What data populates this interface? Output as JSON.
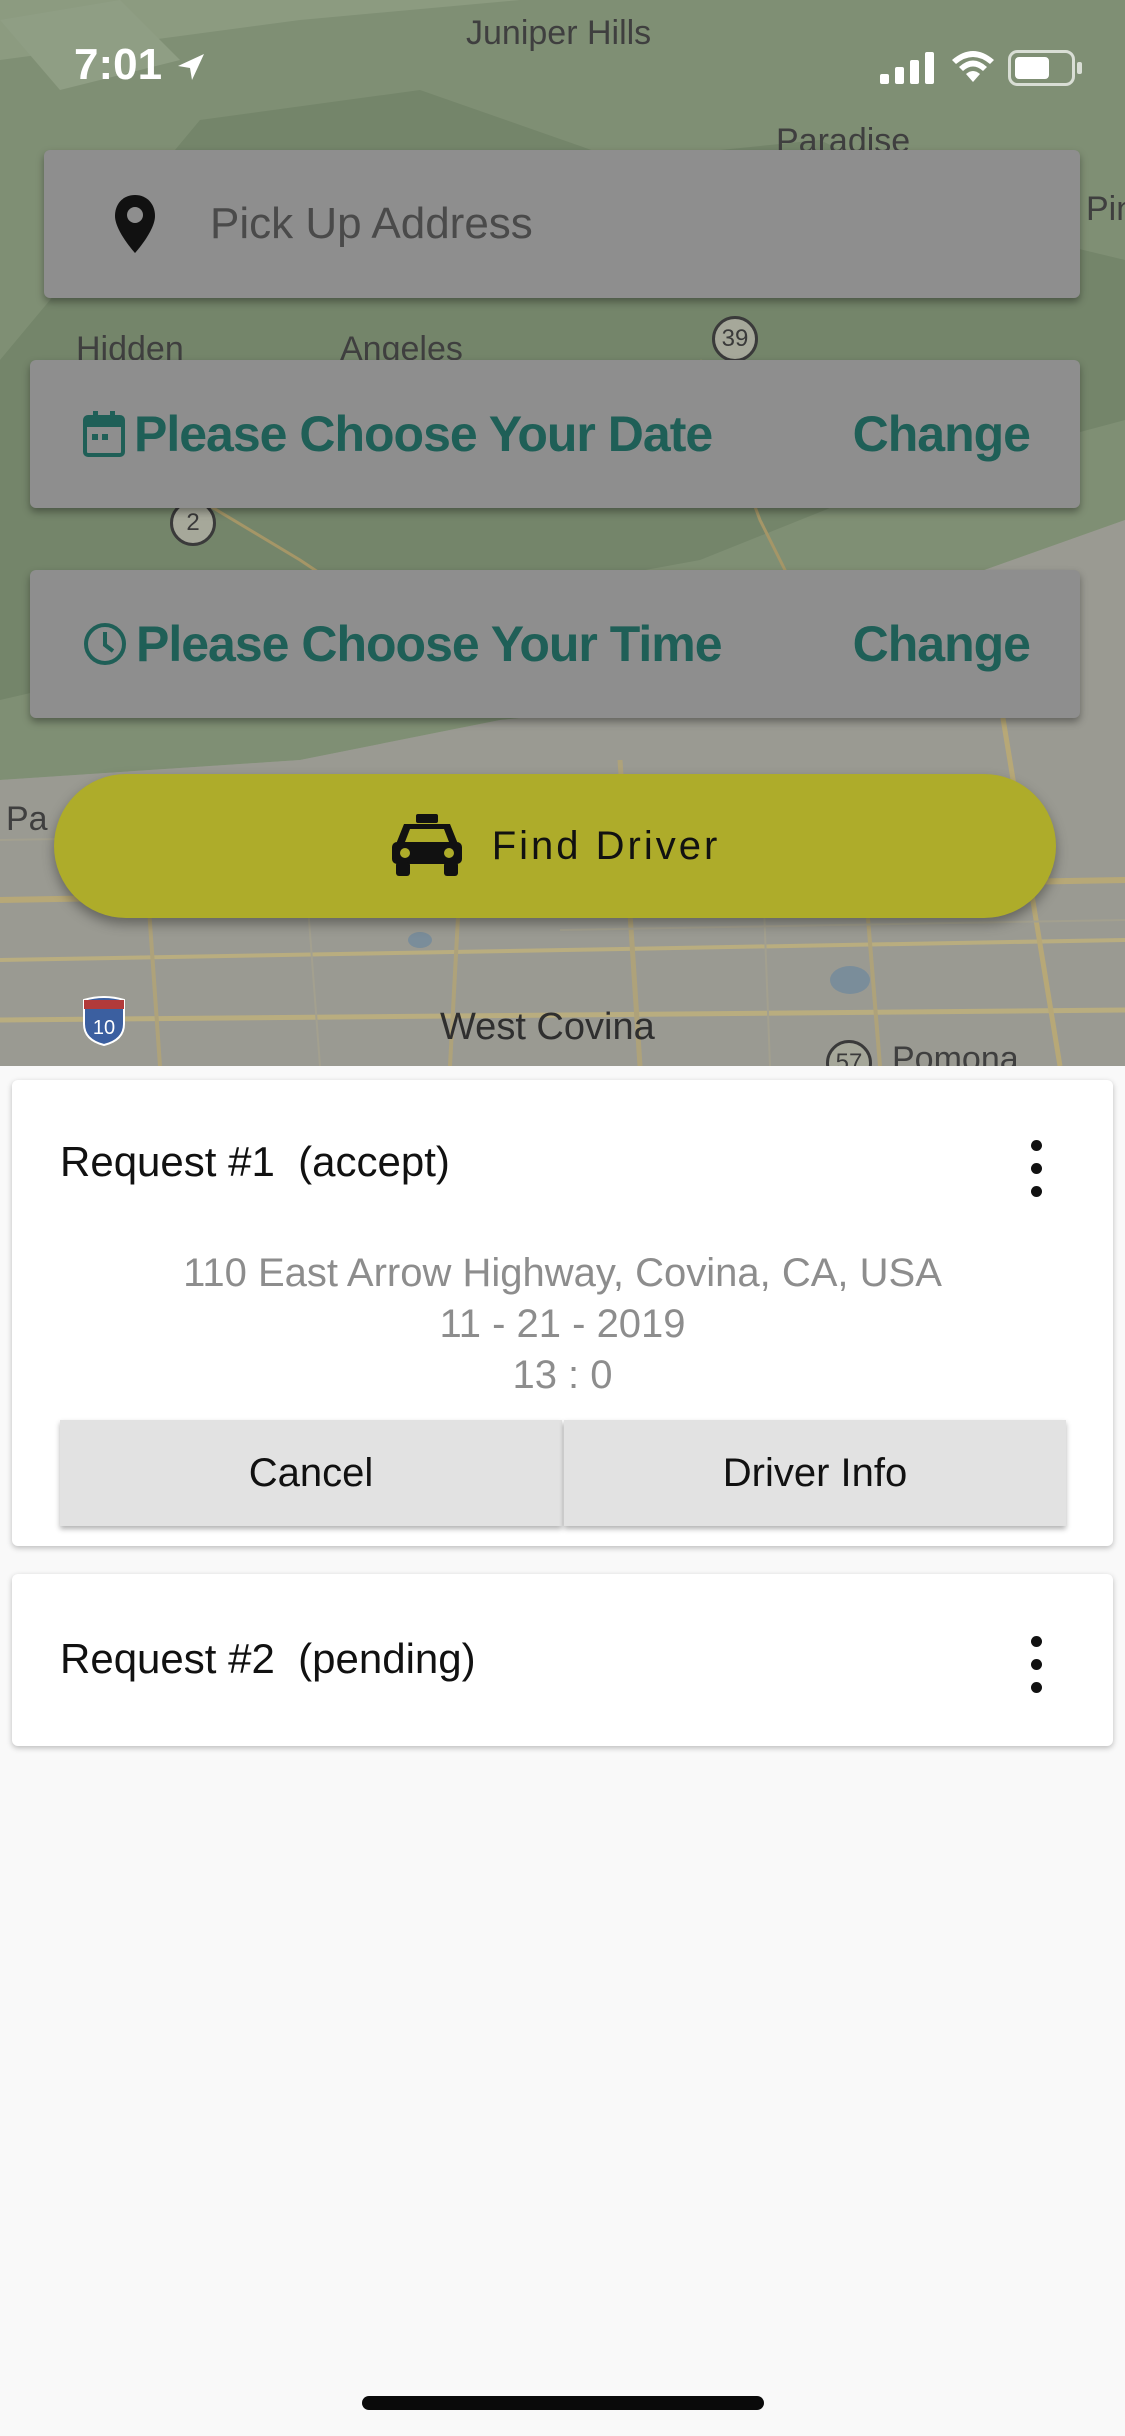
{
  "status_bar": {
    "time": "7:01"
  },
  "map": {
    "labels": {
      "juniper_hills": "Juniper Hills",
      "paradise": "Paradise",
      "pin_partial": "Pin",
      "hidden": "Hidden",
      "angeles": "Angeles",
      "pa_partial": "Pa",
      "west_covina": "West Covina",
      "pomona": "Pomona"
    },
    "route_shields": {
      "ca39": "39",
      "ca2": "2",
      "i10": "10",
      "ca57": "57"
    }
  },
  "pickup": {
    "placeholder": "Pick Up Address",
    "icon": "location-pin-icon"
  },
  "date_picker": {
    "label": "Please Choose Your Date",
    "action": "Change",
    "icon": "calendar-icon"
  },
  "time_picker": {
    "label": "Please Choose Your Time",
    "action": "Change",
    "icon": "clock-icon"
  },
  "find_driver": {
    "label": "Find Driver",
    "icon": "taxi-icon"
  },
  "requests": [
    {
      "title": "Request #1  (accept)",
      "address": "110 East Arrow Highway, Covina, CA, USA",
      "date": "11 - 21 - 2019",
      "time": "13 : 0",
      "cancel_label": "Cancel",
      "driver_info_label": "Driver Info"
    },
    {
      "title": "Request #2  (pending)"
    }
  ],
  "colors": {
    "accent_text": "#1f5f57",
    "find_driver_bg": "#aeac2a",
    "overlay_field": "#8e8e8e"
  }
}
